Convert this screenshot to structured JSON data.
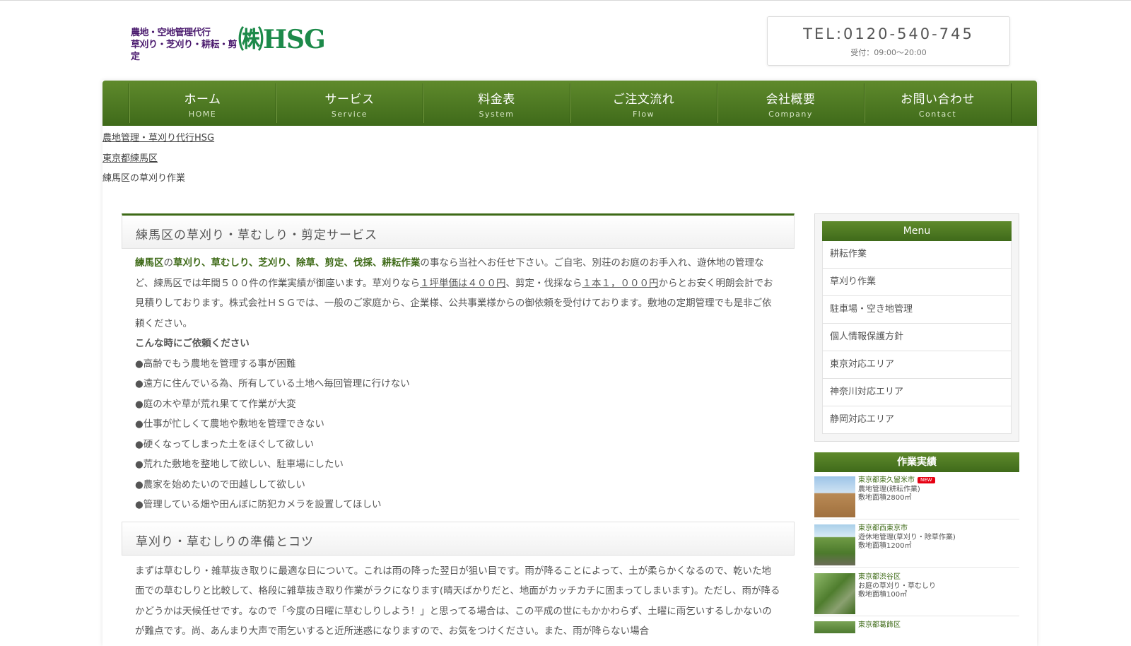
{
  "header": {
    "logo_line1": "農地・空地管理代行",
    "logo_line2": "草刈り・芝刈り・耕耘・剪定",
    "logo_brand": "㈱HSG",
    "tel": "TEL:0120-540-745",
    "hours": "受付：09:00〜20:00"
  },
  "nav": [
    {
      "jp": "ホーム",
      "en": "HOME"
    },
    {
      "jp": "サービス",
      "en": "Service"
    },
    {
      "jp": "料金表",
      "en": "System"
    },
    {
      "jp": "ご注文流れ",
      "en": "Flow"
    },
    {
      "jp": "会社概要",
      "en": "Company"
    },
    {
      "jp": "お問い合わせ",
      "en": "Contact"
    }
  ],
  "breadcrumb": [
    "農地管理・草刈り代行HSG",
    "東京都練馬区",
    "練馬区の草刈り作業"
  ],
  "main": {
    "section1_title": "練馬区の草刈り・草むしり・剪定サービス",
    "p1_a": "練馬区",
    "p1_b": "の",
    "p1_c": "草刈り、草むしり、芝刈り、除草、剪定、伐採、耕耘作業",
    "p1_d": "の事なら当社へお任せ下さい。ご自宅、別荘のお庭のお手入れ、遊休地の管理など、練馬区では年間５００件の作業実績が御座います。草刈りなら",
    "p1_link1": "１坪単価は４００円",
    "p1_e": "、剪定・伐採なら",
    "p1_link2": "１本１，０００円",
    "p1_f": "からとお安く明朗会計でお見積りしております。株式会社ＨＳＧでは、一般のご家庭から、企業様、公共事業様からの御依頼を受付けております。敷地の定期管理でも是非ご依頼ください。",
    "request_heading": "こんな時にご依頼ください",
    "bullets": [
      "●高齢でもう農地を管理する事が困難",
      "●遠方に住んでいる為、所有している土地へ毎回管理に行けない",
      "●庭の木や草が荒れ果てて作業が大変",
      "●仕事が忙しくて農地や敷地を管理できない",
      "●硬くなってしまった土をほぐして欲しい",
      "●荒れた敷地を整地して欲しい、駐車場にしたい",
      "●農家を始めたいので田越しして欲しい",
      "●管理している畑や田んぼに防犯カメラを設置してほしい"
    ],
    "section2_title": "草刈り・草むしりの準備とコツ",
    "p2": "まずは草むしり・雑草抜き取りに最適な日について。これは雨の降った翌日が狙い目です。雨が降ることによって、土が柔らかくなるので、乾いた地面での草むしりと比較して、格段に雑草抜き取り作業がラクになります(晴天ばかりだと、地面がカッチカチに固まってしまいます)。ただし、雨が降るかどうかは天候任せです。なので「今度の日曜に草むしりしよう！」と思ってる場合は、この平成の世にもかかわらず、土曜に雨乞いするしかないのが難点です。尚、あんまり大声で雨乞いすると近所迷惑になりますので、お気をつけください。また、雨が降らない場合"
  },
  "sidebar": {
    "menu_title": "Menu",
    "menu_items": [
      "耕耘作業",
      "草刈り作業",
      "駐車場・空き地管理",
      "個人情報保護方針",
      "東京対応エリア",
      "神奈川対応エリア",
      "静岡対応エリア"
    ],
    "works_title": "作業実績",
    "works": [
      {
        "place": "東京都東久留米市",
        "badge": "NEW",
        "work": "農地管理(耕耘作業)",
        "area": "敷地面積2800㎡"
      },
      {
        "place": "東京都西東京市",
        "work": "遊休地管理(草刈り・除草作業)",
        "area": "敷地面積1200㎡"
      },
      {
        "place": "東京都渋谷区",
        "work": "お庭の草刈り・草むしり",
        "area": "敷地面積100㎡"
      },
      {
        "place": "東京都葛飾区",
        "work": "",
        "area": ""
      }
    ]
  }
}
